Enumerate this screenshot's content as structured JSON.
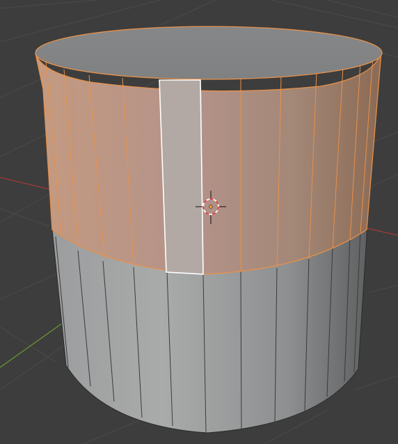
{
  "viewport": {
    "background_color": "#3d3d3d",
    "grid_line_color": "#4b4b4b",
    "x_axis_color": "#a33a3a",
    "y_axis_color": "#6c9a2c"
  },
  "mesh": {
    "object": "cylinder",
    "vertex_count": 32,
    "edit_mode": "face-select",
    "selection_color": "#e8914a",
    "active_face_color": "#ffffff",
    "base_color": "#a4a6a6"
  },
  "cursor_3d": {
    "icon": "3d-cursor-icon",
    "ring_colors": [
      "#d83c3c",
      "#ffffff"
    ]
  },
  "origin": {
    "icon": "origin-point-icon",
    "color": "#f0a030"
  }
}
